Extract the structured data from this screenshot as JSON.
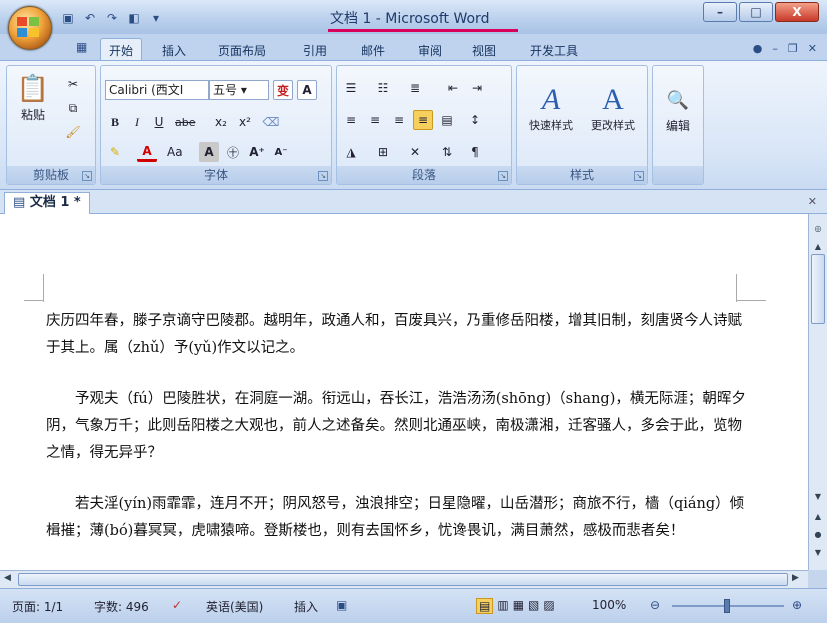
{
  "window": {
    "title": "文档 1 - Microsoft Word",
    "minimize": "–",
    "maximize": "□",
    "close": "X"
  },
  "tabs": [
    {
      "label": "开始"
    },
    {
      "label": "插入"
    },
    {
      "label": "页面布局"
    },
    {
      "label": "引用"
    },
    {
      "label": "邮件"
    },
    {
      "label": "审阅"
    },
    {
      "label": "视图"
    },
    {
      "label": "开发工具"
    }
  ],
  "ribbon": {
    "clipboard": {
      "label": "剪贴板",
      "paste": "粘贴"
    },
    "font": {
      "label": "字体",
      "font_name": "Calibri (西文I",
      "font_size": "五号",
      "grow": "A",
      "bold": "B",
      "italic": "I",
      "underline": "U",
      "strike": "abe",
      "subscript": "x₂",
      "superscript": "x²",
      "case": "Aa",
      "wen": "变"
    },
    "paragraph": {
      "label": "段落"
    },
    "styles": {
      "label": "样式",
      "quick": "快速样式",
      "change": "更改样式"
    },
    "editing": {
      "label": "编辑"
    }
  },
  "document": {
    "tab_label": "文档 1 *",
    "paragraphs": [
      "庆历四年春，滕子京谪守巴陵郡。越明年，政通人和，百废具兴，乃重修岳阳楼，增其旧制，刻唐贤今人诗赋于其上。属（zhǔ）予(yǔ)作文以记之。",
      "予观夫（fú）巴陵胜状，在洞庭一湖。衔远山，吞长江，浩浩汤汤(shōng)（shang)，横无际涯；朝晖夕阴，气象万千；此则岳阳楼之大观也，前人之述备矣。然则北通巫峡，南极潇湘，迁客骚人，多会于此，览物之情，得无异乎？",
      "若夫淫(yín)雨霏霏，连月不开；阴风怒号，浊浪排空；日星隐曜，山岳潜形；商旅不行，樯（qiáng）倾楫摧；薄(bó)暮冥冥，虎啸猿啼。登斯楼也，则有去国怀乡，忧谗畏讥，满目萧然，感极而悲者矣！"
    ]
  },
  "status": {
    "page": "页面: 1/1",
    "words": "字数: 496",
    "language": "英语(美国)",
    "mode": "插入",
    "zoom": "100%"
  }
}
